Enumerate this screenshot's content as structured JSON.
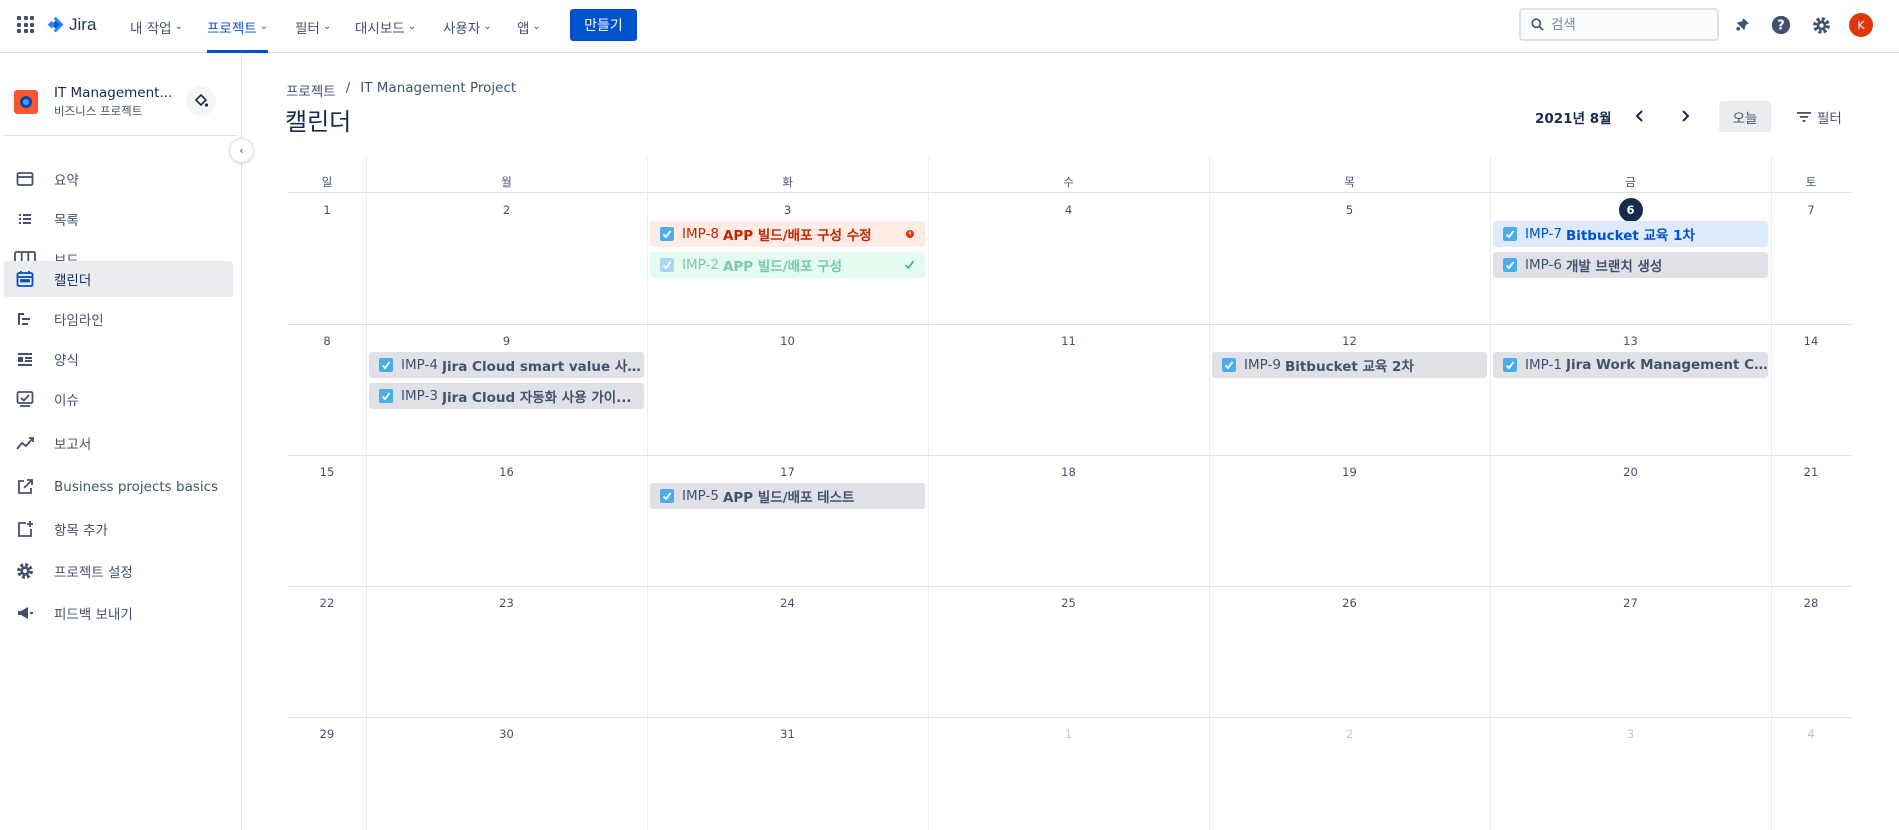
{
  "topnav": {
    "logo": "Jira",
    "items": [
      {
        "label": "내 작업"
      },
      {
        "label": "프로젝트"
      },
      {
        "label": "필터"
      },
      {
        "label": "대시보드"
      },
      {
        "label": "사용자"
      },
      {
        "label": "앱"
      }
    ],
    "create_label": "만들기",
    "search_placeholder": "검색",
    "avatar_initial": "K"
  },
  "sidebar": {
    "project_name": "IT Management...",
    "project_type": "비즈니스 프로젝트",
    "items": [
      {
        "label": "요약",
        "icon": "summary-icon"
      },
      {
        "label": "목록",
        "icon": "list-icon"
      },
      {
        "label": "보드",
        "icon": "board-icon"
      },
      {
        "label": "캘린더",
        "icon": "calendar-icon",
        "active": true
      },
      {
        "label": "타임라인",
        "icon": "timeline-icon"
      },
      {
        "label": "양식",
        "icon": "form-icon"
      },
      {
        "label": "이슈",
        "icon": "issues-icon"
      },
      {
        "label": "보고서",
        "icon": "reports-icon"
      },
      {
        "label": "Business projects basics",
        "icon": "external-link-icon"
      },
      {
        "label": "항목 추가",
        "icon": "add-item-icon"
      },
      {
        "label": "프로젝트 설정",
        "icon": "settings-icon"
      },
      {
        "label": "피드백 보내기",
        "icon": "megaphone-icon"
      }
    ]
  },
  "main": {
    "breadcrumb": [
      "프로젝트",
      "/",
      "IT Management Project"
    ],
    "title": "캘린더",
    "month": "2021년 8월",
    "today_label": "오늘",
    "filter_label": "필터"
  },
  "calendar": {
    "weekdays": [
      "일",
      "월",
      "화",
      "수",
      "목",
      "금",
      "토"
    ],
    "weeks": [
      [
        "1",
        "2",
        "3",
        "4",
        "5",
        "6",
        "7"
      ],
      [
        "8",
        "9",
        "10",
        "11",
        "12",
        "13",
        "14"
      ],
      [
        "15",
        "16",
        "17",
        "18",
        "19",
        "20",
        "21"
      ],
      [
        "22",
        "23",
        "24",
        "25",
        "26",
        "27",
        "28"
      ],
      [
        "29",
        "30",
        "31",
        "1",
        "2",
        "3",
        "4"
      ]
    ],
    "today": "6",
    "events": [
      {
        "key": "IMP-8",
        "summary": "APP 빌드/배포 구성 수정",
        "day": "3",
        "style": "red"
      },
      {
        "key": "IMP-2",
        "summary": "APP 빌드/배포 구성",
        "day": "3",
        "style": "green"
      },
      {
        "key": "IMP-7",
        "summary": "Bitbucket 교육 1차",
        "day": "6",
        "style": "blue"
      },
      {
        "key": "IMP-6",
        "summary": "개발 브랜치 생성",
        "day": "6",
        "style": "grey"
      },
      {
        "key": "IMP-4",
        "summary": "Jira Cloud smart value 사용 ...",
        "day": "9",
        "style": "grey"
      },
      {
        "key": "IMP-3",
        "summary": "Jira Cloud 자동화 사용 가이...",
        "day": "9",
        "style": "grey"
      },
      {
        "key": "IMP-9",
        "summary": "Bitbucket 교육 2차",
        "day": "12",
        "style": "grey"
      },
      {
        "key": "IMP-1",
        "summary": "Jira Work Management Clou...",
        "day": "13",
        "style": "grey"
      },
      {
        "key": "IMP-5",
        "summary": "APP 빌드/배포 테스트",
        "day": "17",
        "style": "grey"
      }
    ]
  },
  "colors": {
    "brand": "#0052CC",
    "text": "#172B4D",
    "checkbox": "#4BADE8"
  }
}
